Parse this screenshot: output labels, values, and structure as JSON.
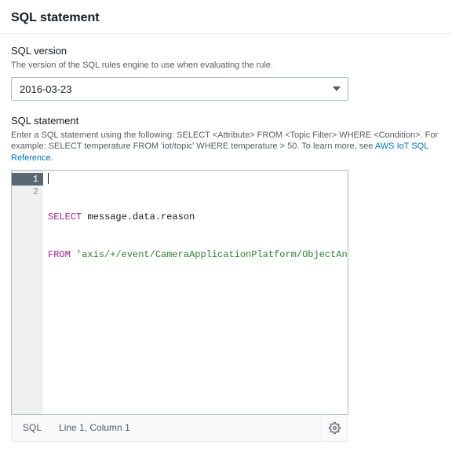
{
  "header": {
    "title": "SQL statement"
  },
  "sql_version": {
    "label": "SQL version",
    "description": "The version of the SQL rules engine to use when evaluating the rule.",
    "value": "2016-03-23"
  },
  "sql_statement": {
    "label": "SQL statement",
    "description_prefix": "Enter a SQL statement using the following: SELECT <Attribute> FROM <Topic Filter> WHERE <Condition>. For example: SELECT temperature FROM 'iot/topic' WHERE temperature > 50. To learn more, see ",
    "reference_link_text": "AWS IoT SQL Reference",
    "description_suffix": ".",
    "code": {
      "line1_kw": "SELECT",
      "line1_rest": " message.data.reason",
      "line2_kw": "FROM",
      "line2_space": " ",
      "line2_str": "'axis/+/event/CameraApplicationPlatform/ObjectAnalytics/#'"
    },
    "gutter": {
      "l1": "1",
      "l2": "2"
    }
  },
  "statusbar": {
    "language": "SQL",
    "position": "Line 1, Column 1"
  }
}
